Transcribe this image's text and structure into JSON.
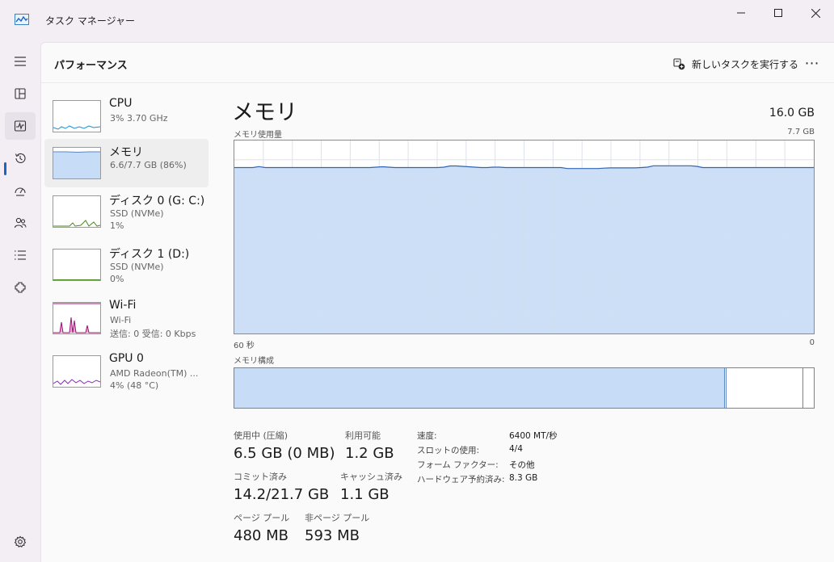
{
  "app": {
    "title": "タスク マネージャー"
  },
  "header": {
    "page_title": "パフォーマンス",
    "new_task": "新しいタスクを実行する",
    "more": "⋯"
  },
  "rail": [
    {
      "name": "menu-icon"
    },
    {
      "name": "processes-icon"
    },
    {
      "name": "performance-icon",
      "active": true
    },
    {
      "name": "app-history-icon"
    },
    {
      "name": "startup-apps-icon"
    },
    {
      "name": "users-icon"
    },
    {
      "name": "details-icon"
    },
    {
      "name": "services-icon"
    },
    {
      "name": "settings-icon"
    }
  ],
  "devices": [
    {
      "id": "cpu",
      "name": "CPU",
      "line2": "3%  3.70 GHz",
      "line3": "",
      "color": "#1b8fd4"
    },
    {
      "id": "memory",
      "name": "メモリ",
      "line2": "6.6/7.7 GB (86%)",
      "line3": "",
      "color": "#5c86c4",
      "active": true
    },
    {
      "id": "disk0",
      "name": "ディスク 0 (G: C:)",
      "line2": "SSD (NVMe)",
      "line3": "1%",
      "color": "#4c8a1e"
    },
    {
      "id": "disk1",
      "name": "ディスク 1 (D:)",
      "line2": "SSD (NVMe)",
      "line3": "0%",
      "color": "#4c8a1e"
    },
    {
      "id": "wifi",
      "name": "Wi-Fi",
      "line2": "Wi-Fi",
      "line3": "送信: 0 受信: 0 Kbps",
      "color": "#a3127a"
    },
    {
      "id": "gpu0",
      "name": "GPU 0",
      "line2": "AMD Radeon(TM) ...",
      "line3": "4% (48 °C)",
      "color": "#8a2bb3"
    }
  ],
  "detail": {
    "title": "メモリ",
    "total": "16.0 GB",
    "usage_label": "メモリ使用量",
    "usage_max": "7.7 GB",
    "time_left": "60 秒",
    "time_right": "0",
    "composition_label": "メモリ構成",
    "composition": {
      "in_use_fraction": 0.846,
      "standby_fraction": 0.134
    }
  },
  "usage_history": [
    0.86,
    0.86,
    0.86,
    0.86,
    0.865,
    0.86,
    0.86,
    0.86,
    0.86,
    0.86,
    0.86,
    0.86,
    0.86,
    0.86,
    0.86,
    0.86,
    0.86,
    0.86,
    0.86,
    0.86,
    0.86,
    0.86,
    0.86,
    0.862,
    0.864,
    0.862,
    0.86,
    0.86,
    0.86,
    0.86,
    0.86,
    0.86,
    0.86,
    0.86,
    0.862,
    0.868,
    0.868,
    0.866,
    0.864,
    0.862,
    0.86,
    0.86,
    0.862,
    0.862,
    0.86,
    0.86,
    0.86,
    0.86,
    0.86,
    0.86,
    0.86,
    0.86,
    0.86,
    0.86,
    0.855,
    0.855,
    0.855,
    0.855,
    0.855,
    0.855,
    0.857,
    0.858,
    0.858,
    0.858,
    0.858,
    0.858,
    0.86,
    0.862,
    0.869,
    0.869,
    0.869,
    0.869,
    0.869,
    0.869,
    0.869,
    0.866,
    0.86,
    0.86,
    0.86,
    0.86,
    0.86,
    0.86,
    0.86,
    0.86,
    0.86,
    0.86,
    0.86,
    0.86,
    0.86,
    0.86,
    0.86,
    0.86,
    0.86,
    0.86,
    0.86
  ],
  "stats": {
    "in_use_label": "使用中 (圧縮)",
    "in_use_value": "6.5 GB (0 MB)",
    "available_label": "利用可能",
    "available_value": "1.2 GB",
    "committed_label": "コミット済み",
    "committed_value": "14.2/21.7 GB",
    "cached_label": "キャッシュ済み",
    "cached_value": "1.1 GB",
    "paged_label": "ページ プール",
    "paged_value": "480 MB",
    "nonpaged_label": "非ページ プール",
    "nonpaged_value": "593 MB"
  },
  "specs": [
    {
      "key": "速度:",
      "value": "6400 MT/秒"
    },
    {
      "key": "スロットの使用:",
      "value": "4/4"
    },
    {
      "key": "フォーム ファクター:",
      "value": "その他"
    },
    {
      "key": "ハードウェア予約済み:",
      "value": "8.3 GB"
    }
  ]
}
